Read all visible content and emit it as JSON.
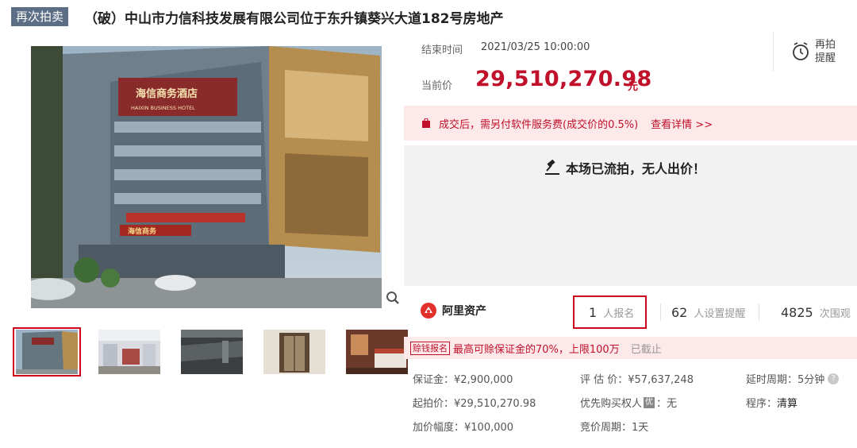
{
  "title": {
    "tag": "再次拍卖",
    "text": "（破）中山市力信科技发展有限公司位于东升镇葵兴大道182号房地产"
  },
  "gallery": {
    "sign_main": "海信商务酒店",
    "sign_sub": "HAIXIN BUSINESS HOTEL",
    "sign_lower": "海信商务",
    "thumb_count": 5,
    "active_index": 0
  },
  "auction": {
    "end_label": "结束时间",
    "end_time": "2021/03/25 10:00:00",
    "price_label": "当前价",
    "price": "29,510,270.98",
    "price_unit": "元",
    "remind": "再拍提醒"
  },
  "notice": {
    "text": "成交后，需另付软件服务费(成交价的0.5%)",
    "link": "查看详情 >>"
  },
  "status": {
    "text": "本场已流拍，无人出价！"
  },
  "stats": {
    "platform": "阿里资产",
    "signup_count": "1",
    "signup_unit": "人报名",
    "remind_count": "62",
    "remind_unit": "人设置提醒",
    "view_count": "4825",
    "view_unit": "次围观"
  },
  "promo": {
    "badge": "赊钱报名",
    "text": "最高可赊保证金的70%，上限100万",
    "status": "已截止"
  },
  "details": {
    "deposit": "保证金：¥2,900,000",
    "appraisal": "评 估 价：¥57,637,248",
    "delay": "延时周期：5分钟",
    "start_price": "起拍价：¥29,510,270.98",
    "priority_label": "优先购买权人",
    "priority_badge": "优",
    "priority_value": "：无",
    "procedure_label": "程序：",
    "procedure_value": "清算",
    "increment": "加价幅度：¥100,000",
    "cycle": "竞价周期：1天"
  },
  "colors": {
    "accent": "#c0102a",
    "tag_bg": "#5c6e86",
    "notice_bg": "#fde9ea",
    "panel_bg": "#f2f2f2"
  }
}
